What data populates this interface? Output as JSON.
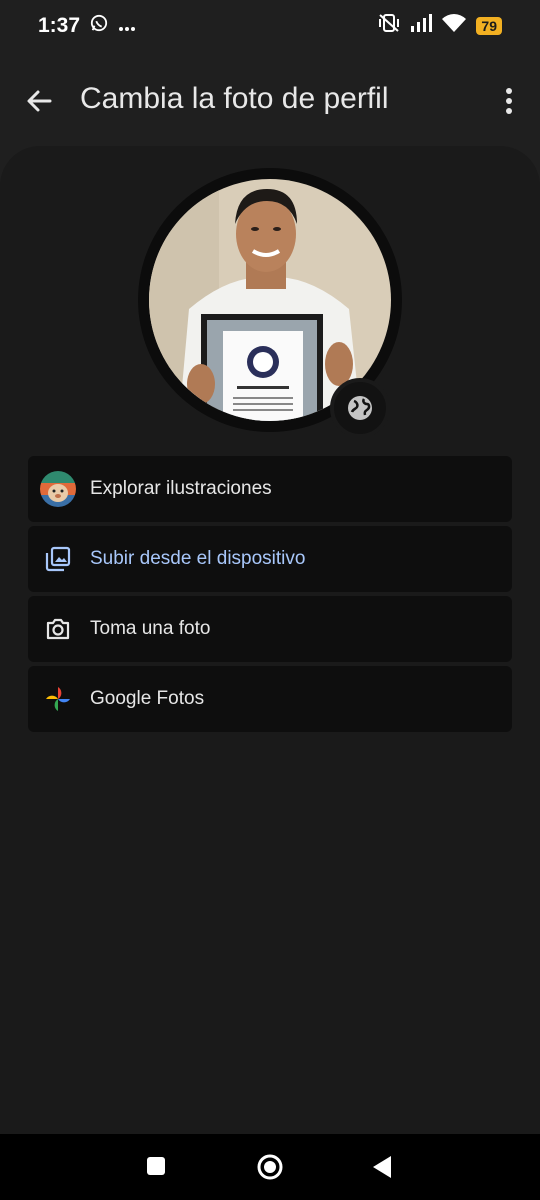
{
  "status": {
    "time": "1:37",
    "battery": "79",
    "icons": [
      "whatsapp-icon",
      "more-dots-icon",
      "mute-vibrate-icon",
      "signal-icon",
      "wifi-icon",
      "battery-icon"
    ]
  },
  "header": {
    "title": "Cambia la foto de perfil",
    "back_icon": "arrow-back-icon",
    "menu_icon": "more-vert-icon"
  },
  "profile": {
    "photo": "profile-photo",
    "badge_icon": "globe-icon"
  },
  "options": [
    {
      "label": "Explorar ilustraciones",
      "icon": "illustration-avatar-icon"
    },
    {
      "label": "Subir desde el dispositivo",
      "icon": "photo-library-icon"
    },
    {
      "label": "Toma una foto",
      "icon": "camera-icon"
    },
    {
      "label": "Google Fotos",
      "icon": "google-photos-icon"
    }
  ],
  "colors": {
    "background": "#1f1f1f",
    "sheet": "#1a1a1a",
    "option_bg": "#0e0e0e",
    "accent": "#a8c7fa",
    "battery": "#f2b022"
  },
  "nav": {
    "icons": [
      "recents-square-icon",
      "home-circle-icon",
      "back-triangle-icon"
    ]
  }
}
